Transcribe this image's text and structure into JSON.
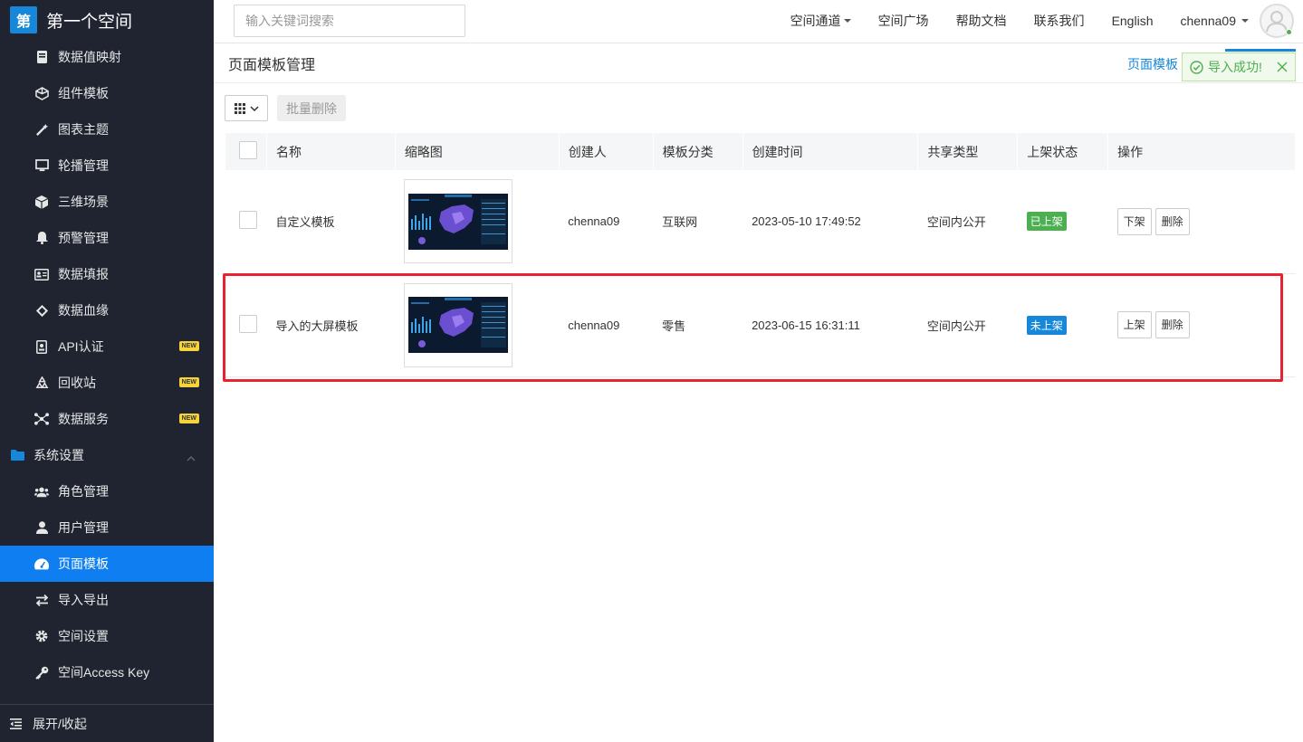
{
  "brand": {
    "logo_char": "第",
    "title": "第一个空间"
  },
  "sidebar": {
    "items": [
      {
        "id": "data-mapping",
        "label": "数据值映射",
        "icon": "book-icon"
      },
      {
        "id": "component-template",
        "label": "组件模板",
        "icon": "cube-outline-icon"
      },
      {
        "id": "chart-theme",
        "label": "图表主题",
        "icon": "magic-wand-icon"
      },
      {
        "id": "carousel",
        "label": "轮播管理",
        "icon": "monitor-icon"
      },
      {
        "id": "3d-scene",
        "label": "三维场景",
        "icon": "cube-icon"
      },
      {
        "id": "alert",
        "label": "预警管理",
        "icon": "bell-icon"
      },
      {
        "id": "data-report",
        "label": "数据填报",
        "icon": "id-card-icon"
      },
      {
        "id": "lineage",
        "label": "数据血缘",
        "icon": "layers-icon"
      },
      {
        "id": "api-auth",
        "label": "API认证",
        "icon": "id-badge-icon",
        "badge": "NEW"
      },
      {
        "id": "recycle",
        "label": "回收站",
        "icon": "recycle-icon",
        "badge": "NEW"
      },
      {
        "id": "data-service",
        "label": "数据服务",
        "icon": "network-icon",
        "badge": "NEW"
      }
    ],
    "group": {
      "label": "系统设置",
      "icon": "folder-icon"
    },
    "sub_items": [
      {
        "id": "roles",
        "label": "角色管理",
        "icon": "users-icon"
      },
      {
        "id": "users",
        "label": "用户管理",
        "icon": "user-icon"
      },
      {
        "id": "page-template",
        "label": "页面模板",
        "icon": "dashboard-icon",
        "active": true
      },
      {
        "id": "import-export",
        "label": "导入导出",
        "icon": "exchange-icon"
      },
      {
        "id": "space-settings",
        "label": "空间设置",
        "icon": "gear-icon"
      },
      {
        "id": "access-key",
        "label": "空间Access Key",
        "icon": "key-icon"
      }
    ],
    "collapse_label": "展开/收起"
  },
  "header": {
    "search_placeholder": "输入关键词搜索",
    "nav": [
      "空间通道",
      "空间广场",
      "帮助文档",
      "联系我们",
      "English"
    ],
    "username": "chenna09"
  },
  "page": {
    "title": "页面模板管理",
    "head_link": "页面模板",
    "batch_delete": "批量删除"
  },
  "table": {
    "columns": [
      "名称",
      "缩略图",
      "创建人",
      "模板分类",
      "创建时间",
      "共享类型",
      "上架状态",
      "操作"
    ],
    "rows": [
      {
        "name": "自定义模板",
        "creator": "chenna09",
        "category": "互联网",
        "created": "2023-05-10 17:49:52",
        "share": "空间内公开",
        "status": "已上架",
        "status_color": "#4caf50",
        "actions": [
          "下架",
          "删除"
        ]
      },
      {
        "name": "导入的大屏模板",
        "creator": "chenna09",
        "category": "零售",
        "created": "2023-06-15 16:31:11",
        "share": "空间内公开",
        "status": "未上架",
        "status_color": "#1687d9",
        "actions": [
          "上架",
          "删除"
        ]
      }
    ]
  },
  "toast": {
    "message": "导入成功!"
  },
  "colors": {
    "sidebar_bg": "#1f2430",
    "active": "#0f7ef0",
    "link": "#1687d9",
    "highlight": "#e8232f",
    "success": "#4caf50"
  }
}
